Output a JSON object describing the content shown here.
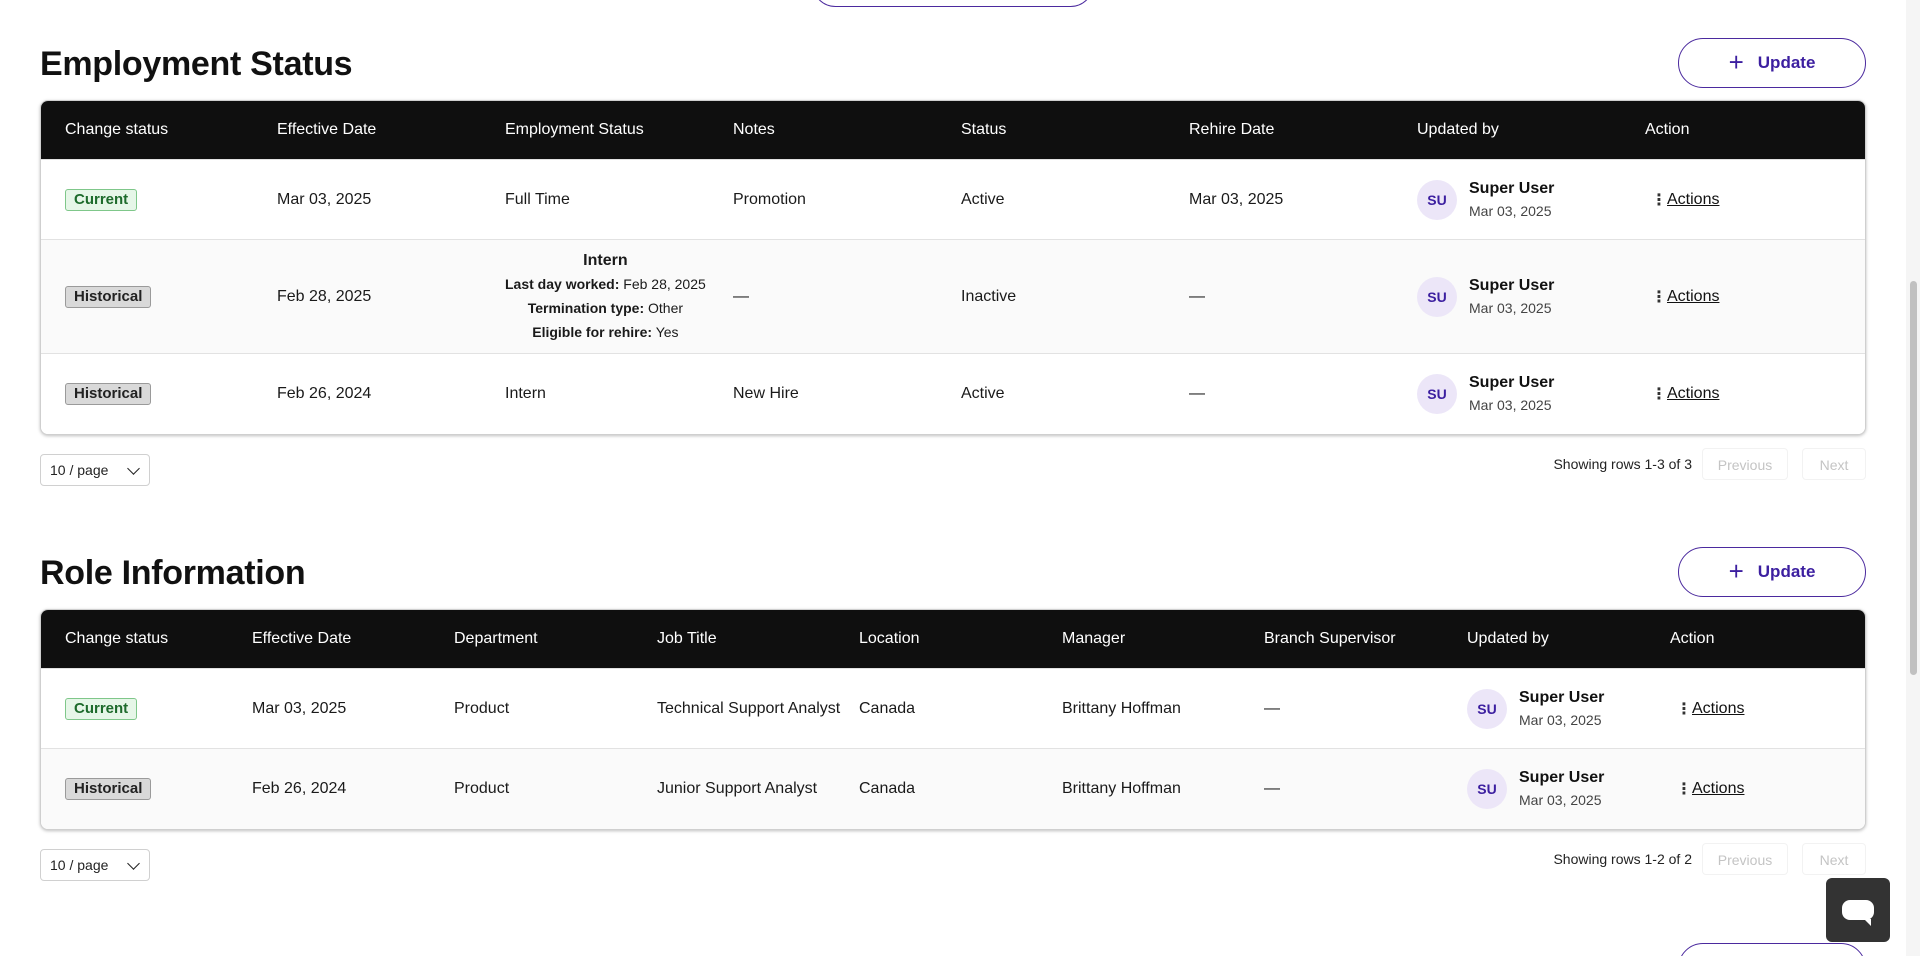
{
  "employment": {
    "title": "Employment Status",
    "update_label": "Update",
    "columns": [
      "Change status",
      "Effective Date",
      "Employment Status",
      "Notes",
      "Status",
      "Rehire Date",
      "Updated by",
      "Action"
    ],
    "rows": [
      {
        "change_status": "Current",
        "effective_date": "Mar 03, 2025",
        "employment_status": "Full Time",
        "notes": "Promotion",
        "status": "Active",
        "rehire_date": "Mar 03, 2025",
        "user_initials": "SU",
        "user_name": "Super User",
        "user_date": "Mar 03, 2025",
        "action": "Actions"
      },
      {
        "change_status": "Historical",
        "effective_date": "Feb 28, 2025",
        "employment_status": "Intern",
        "details": {
          "last_day_label": "Last day worked:",
          "last_day_value": "Feb 28, 2025",
          "termination_label": "Termination type:",
          "termination_value": "Other",
          "rehire_label": "Eligible for rehire:",
          "rehire_value": "Yes"
        },
        "notes": "—",
        "status": "Inactive",
        "rehire_date": "—",
        "user_initials": "SU",
        "user_name": "Super User",
        "user_date": "Mar 03, 2025",
        "action": "Actions"
      },
      {
        "change_status": "Historical",
        "effective_date": "Feb 26, 2024",
        "employment_status": "Intern",
        "notes": "New Hire",
        "status": "Active",
        "rehire_date": "—",
        "user_initials": "SU",
        "user_name": "Super User",
        "user_date": "Mar 03, 2025",
        "action": "Actions"
      }
    ],
    "pagination": {
      "per_page": "10 / page",
      "showing": "Showing rows 1-3 of 3",
      "previous": "Previous",
      "next": "Next"
    }
  },
  "role": {
    "title": "Role Information",
    "update_label": "Update",
    "columns": [
      "Change status",
      "Effective Date",
      "Department",
      "Job Title",
      "Location",
      "Manager",
      "Branch Supervisor",
      "Updated by",
      "Action"
    ],
    "rows": [
      {
        "change_status": "Current",
        "effective_date": "Mar 03, 2025",
        "department": "Product",
        "job_title": "Technical Support Analyst",
        "location": "Canada",
        "manager": "Brittany Hoffman",
        "branch_supervisor": "—",
        "user_initials": "SU",
        "user_name": "Super User",
        "user_date": "Mar 03, 2025",
        "action": "Actions"
      },
      {
        "change_status": "Historical",
        "effective_date": "Feb 26, 2024",
        "department": "Product",
        "job_title": "Junior Support Analyst",
        "location": "Canada",
        "manager": "Brittany Hoffman",
        "branch_supervisor": "—",
        "user_initials": "SU",
        "user_name": "Super User",
        "user_date": "Mar 03, 2025",
        "action": "Actions"
      }
    ],
    "pagination": {
      "per_page": "10 / page",
      "showing": "Showing rows 1-2 of 2",
      "previous": "Previous",
      "next": "Next"
    }
  },
  "colors": {
    "accent": "#3c1fa0",
    "header_bg": "#0f0f0f",
    "current_badge": "#e6f6e8",
    "historical_badge": "#d9d9d9"
  }
}
